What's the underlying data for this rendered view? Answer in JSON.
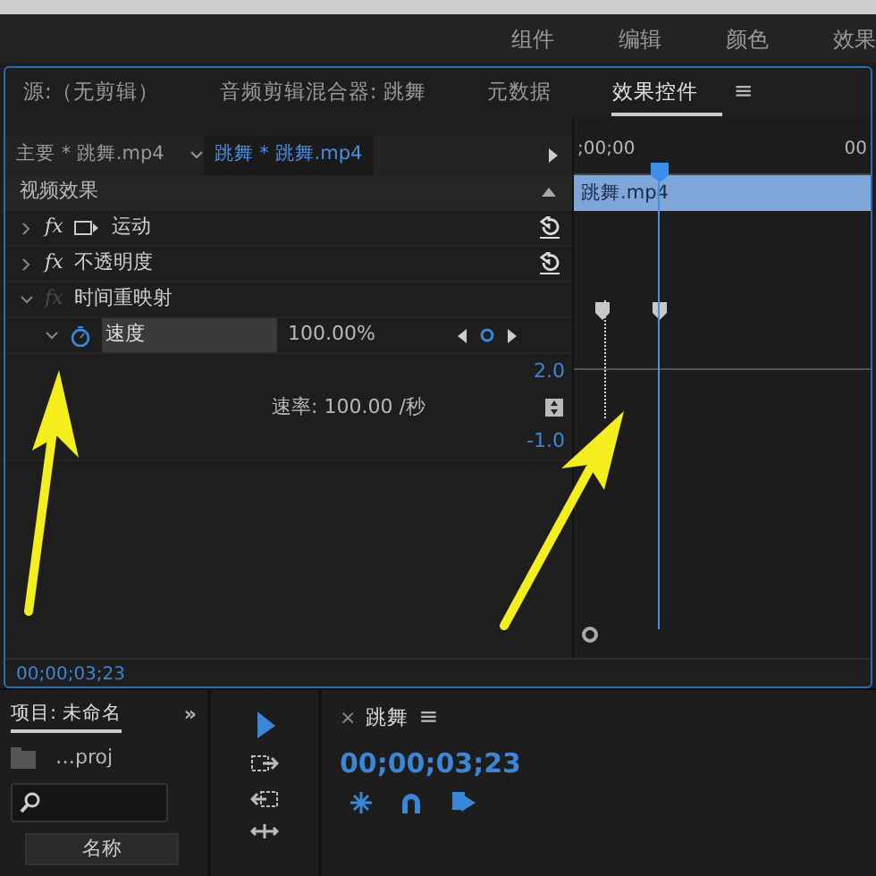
{
  "workspace_tabs": [
    {
      "label": "组件"
    },
    {
      "label": "编辑"
    },
    {
      "label": "颜色"
    },
    {
      "label": "效果"
    }
  ],
  "panel_tabs": [
    {
      "label": "源:（无剪辑）",
      "selected": false
    },
    {
      "label": "音频剪辑混合器: 跳舞",
      "selected": false
    },
    {
      "label": "元数据",
      "selected": false
    },
    {
      "label": "效果控件",
      "selected": true
    }
  ],
  "panel_menu": "≡",
  "effect_controls": {
    "clip_tabs": [
      {
        "label": "主要 * 跳舞.mp4",
        "selected": false
      },
      {
        "label": "跳舞 * 跳舞.mp4",
        "selected": true
      }
    ],
    "section": "视频效果",
    "effects": [
      {
        "fx": "fx",
        "name": "运动",
        "kind": "motion",
        "expanded": false,
        "enabled": true
      },
      {
        "fx": "fx",
        "name": "不透明度",
        "kind": "plain",
        "expanded": false,
        "enabled": true
      },
      {
        "fx": "fx",
        "name": "时间重映射",
        "kind": "plain",
        "expanded": true,
        "enabled": false
      }
    ],
    "property": {
      "name": "速度",
      "value": "100.00%",
      "expanded": true
    },
    "graph": {
      "max": "2.0",
      "rate": "速率: 100.00 /秒",
      "min": "-1.0"
    },
    "timeline": {
      "start": ";00;00",
      "end": "00",
      "clip": "跳舞.mp4"
    },
    "timecode": "00;00;03;23"
  },
  "project": {
    "title": "项目: 未命名",
    "more": "»",
    "file": "…proj",
    "column": "名称"
  },
  "sequence": {
    "close": "×",
    "title": "跳舞",
    "menu": "≡",
    "timecode": "00;00;03;23"
  }
}
